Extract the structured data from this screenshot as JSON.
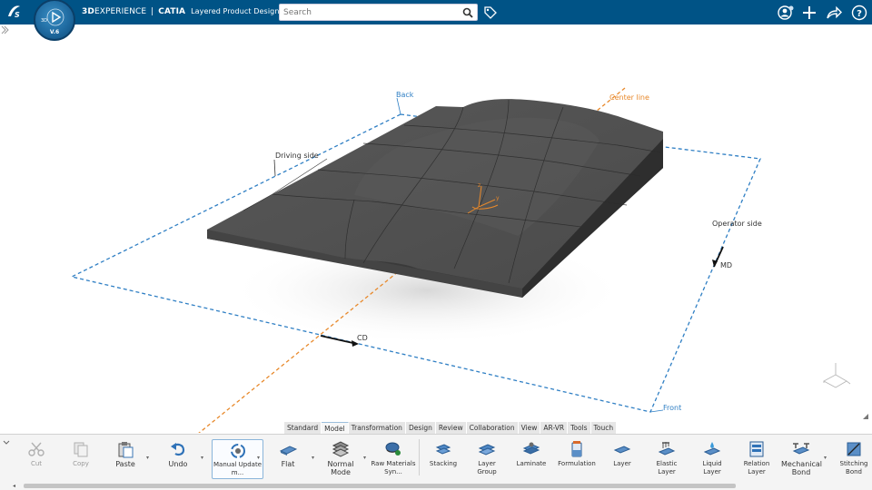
{
  "topbar": {
    "brand_bold": "3D",
    "brand_light": "EXPERIENCE",
    "separator": "|",
    "app_name": "CATIA",
    "product": "Layered Product Design",
    "compass_version": "V.6",
    "compass_left": "3D",
    "search_placeholder": "Search",
    "icons": [
      "ds-logo-icon",
      "search-icon",
      "tag-icon",
      "user-icon",
      "add-icon",
      "share-icon",
      "help-icon"
    ]
  },
  "viewport": {
    "labels": {
      "back": "Back",
      "center_line": "Center line",
      "driving_side": "Driving side",
      "operator_side": "Operator side",
      "md": "MD",
      "cd": "CD",
      "front": "Front"
    },
    "colors": {
      "boundary": "#2f7fc4",
      "center_line": "#e8892b",
      "part": "#4a4a4a"
    }
  },
  "tabs": [
    "Standard",
    "Model",
    "Transformation",
    "Design",
    "Review",
    "Collaboration",
    "View",
    "AR-VR",
    "Tools",
    "Touch"
  ],
  "active_tab": "Model",
  "actions": {
    "cut": "Cut",
    "copy": "Copy",
    "paste": "Paste",
    "undo": "Undo",
    "manual_update": "Manual Update m...",
    "flat": "Flat",
    "normal_mode": "Normal Mode",
    "raw_materials": "Raw Materials Syn...",
    "stacking": "Stacking",
    "layer_group": "Layer Group",
    "laminate": "Laminate",
    "formulation": "Formulation",
    "layer": "Layer",
    "elastic_layer": "Elastic Layer",
    "liquid_layer": "Liquid Layer",
    "relation_layer": "Relation Layer",
    "mechanical_bond": "Mechanical Bond",
    "stitching_bond": "Stitching Bond"
  }
}
